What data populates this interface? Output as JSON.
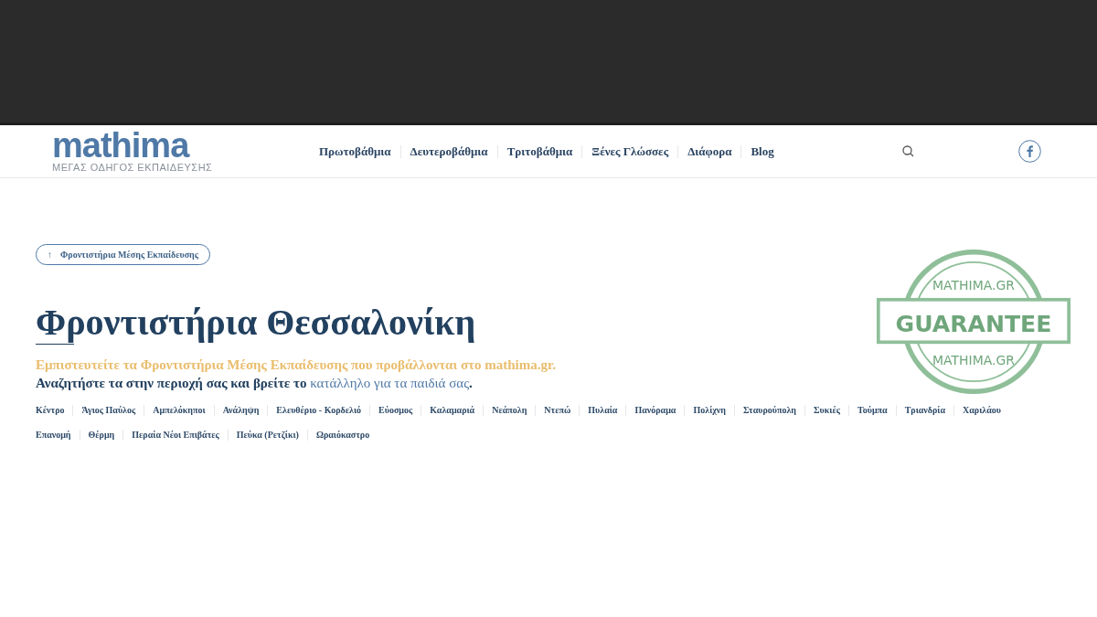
{
  "header": {
    "logo": {
      "name": "mathima",
      "tagline": "ΜΕΓΑΣ ΟΔΗΓΟΣ ΕΚΠΑΙΔΕΥΣΗΣ"
    },
    "nav": [
      {
        "label": "Πρωτοβάθμια"
      },
      {
        "label": "Δευτεροβάθμια"
      },
      {
        "label": "Τριτοβάθμια"
      },
      {
        "label": "Ξένες Γλώσσες"
      },
      {
        "label": "Διάφορα"
      },
      {
        "label": "Blog"
      }
    ]
  },
  "breadcrumb": {
    "icon": "↑",
    "label": "Φροντιστήρια Μέσης Εκπαίδευσης"
  },
  "title": "Φροντιστήρια Θεσσαλονίκη",
  "intro": {
    "line_1": "Εμπιστευτείτε τα Φροντιστήρια Μέσης Εκπαίδευσης που προβάλλονται στο mathima.gr.",
    "line_2_before": "Αναζητήστε τα στην περιοχή σας και βρείτε το ",
    "line_2_link": "κατάλληλο για τα παιδιά σας",
    "line_2_after": "."
  },
  "stamp": {
    "top_text": "MATHIMA.GR",
    "center_text": "GUARANTEE",
    "bottom_text": "MATHIMA.GR"
  },
  "areas": [
    {
      "label": "Κέντρο"
    },
    {
      "label": "Άγιος Παύλος"
    },
    {
      "label": "Αμπελόκηποι"
    },
    {
      "label": "Ανάληψη"
    },
    {
      "label": "Ελευθέριο - Κορδελιό"
    },
    {
      "label": "Εύοσμος"
    },
    {
      "label": "Καλαμαριά"
    },
    {
      "label": "Νεάπολη"
    },
    {
      "label": "Ντεπώ"
    },
    {
      "label": "Πυλαία"
    },
    {
      "label": "Πανόραμα"
    },
    {
      "label": "Πολίχνη"
    },
    {
      "label": "Σταυρούπολη"
    },
    {
      "label": "Συκιές"
    },
    {
      "label": "Τούμπα"
    },
    {
      "label": "Τριανδρία"
    },
    {
      "label": "Χαριλάου"
    },
    {
      "label": "Επανομή"
    },
    {
      "label": "Θέρμη"
    },
    {
      "label": "Περαία Νέοι Επιβάτες"
    },
    {
      "label": "Πεύκα (Ρετζίκι)"
    },
    {
      "label": "Ωραιόκαστρο"
    }
  ]
}
